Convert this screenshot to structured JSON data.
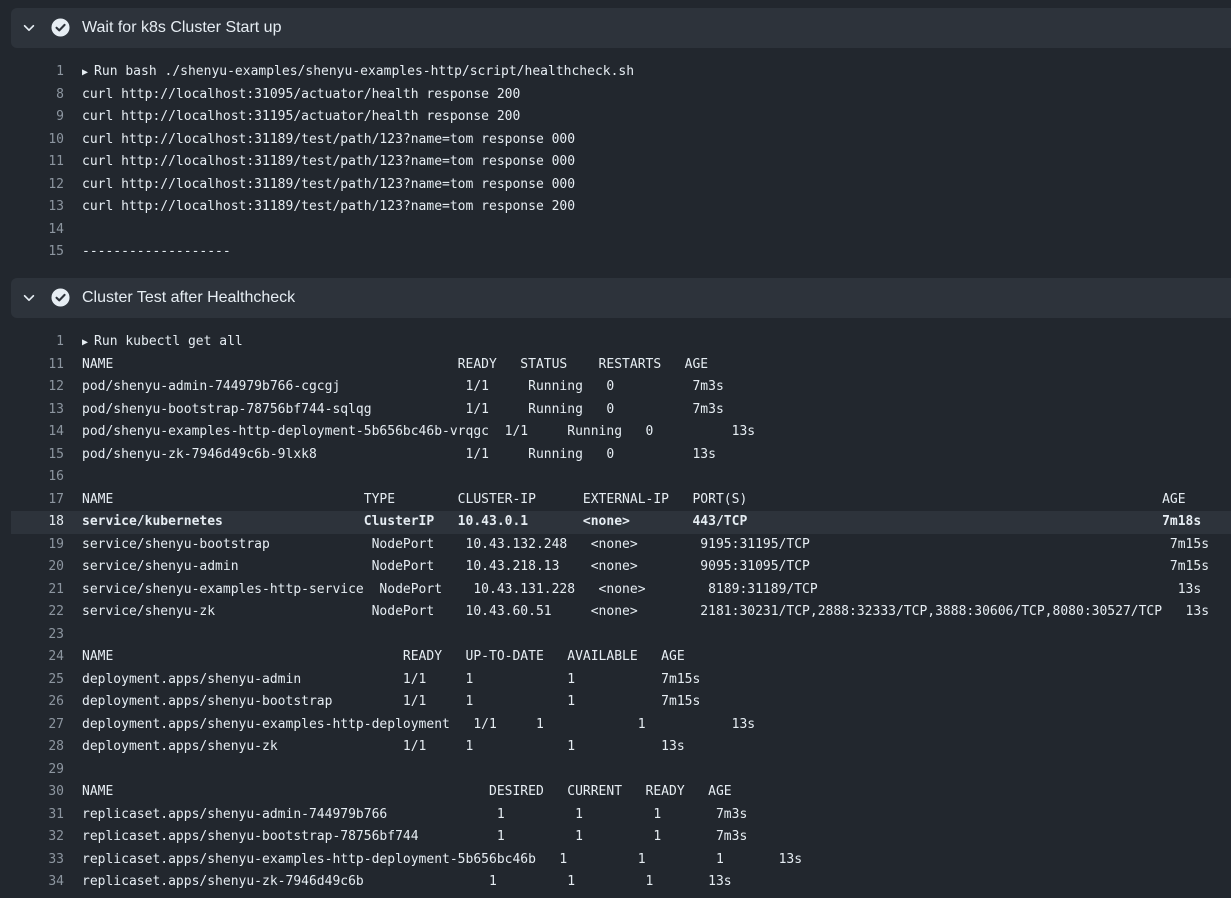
{
  "steps": [
    {
      "title": "Wait for k8s Cluster Start up",
      "status": "success",
      "lines": [
        {
          "num": "1",
          "text": "Run bash ./shenyu-examples/shenyu-examples-http/script/healthcheck.sh",
          "group": true
        },
        {
          "num": "8",
          "text": "curl http://localhost:31095/actuator/health response 200"
        },
        {
          "num": "9",
          "text": "curl http://localhost:31195/actuator/health response 200"
        },
        {
          "num": "10",
          "text": "curl http://localhost:31189/test/path/123?name=tom response 000"
        },
        {
          "num": "11",
          "text": "curl http://localhost:31189/test/path/123?name=tom response 000"
        },
        {
          "num": "12",
          "text": "curl http://localhost:31189/test/path/123?name=tom response 000"
        },
        {
          "num": "13",
          "text": "curl http://localhost:31189/test/path/123?name=tom response 200"
        },
        {
          "num": "14",
          "text": ""
        },
        {
          "num": "15",
          "text": "-------------------"
        }
      ]
    },
    {
      "title": "Cluster Test after Healthcheck",
      "status": "success",
      "lines": [
        {
          "num": "1",
          "text": "Run kubectl get all",
          "group": true
        },
        {
          "num": "11",
          "text": "NAME                                            READY   STATUS    RESTARTS   AGE"
        },
        {
          "num": "12",
          "text": "pod/shenyu-admin-744979b766-cgcgj                1/1     Running   0          7m3s"
        },
        {
          "num": "13",
          "text": "pod/shenyu-bootstrap-78756bf744-sqlqg            1/1     Running   0          7m3s"
        },
        {
          "num": "14",
          "text": "pod/shenyu-examples-http-deployment-5b656bc46b-vrqgc  1/1     Running   0          13s"
        },
        {
          "num": "15",
          "text": "pod/shenyu-zk-7946d49c6b-9lxk8                   1/1     Running   0          13s"
        },
        {
          "num": "16",
          "text": ""
        },
        {
          "num": "17",
          "text": "NAME                                TYPE        CLUSTER-IP      EXTERNAL-IP   PORT(S)                                                     AGE"
        },
        {
          "num": "18",
          "text": "service/kubernetes                  ClusterIP   10.43.0.1       <none>        443/TCP                                                     7m18s",
          "highlight": true
        },
        {
          "num": "19",
          "text": "service/shenyu-bootstrap             NodePort    10.43.132.248   <none>        9195:31195/TCP                                              7m15s"
        },
        {
          "num": "20",
          "text": "service/shenyu-admin                 NodePort    10.43.218.13    <none>        9095:31095/TCP                                              7m15s"
        },
        {
          "num": "21",
          "text": "service/shenyu-examples-http-service  NodePort    10.43.131.228   <none>        8189:31189/TCP                                              13s"
        },
        {
          "num": "22",
          "text": "service/shenyu-zk                    NodePort    10.43.60.51     <none>        2181:30231/TCP,2888:32333/TCP,3888:30606/TCP,8080:30527/TCP   13s"
        },
        {
          "num": "23",
          "text": ""
        },
        {
          "num": "24",
          "text": "NAME                                     READY   UP-TO-DATE   AVAILABLE   AGE"
        },
        {
          "num": "25",
          "text": "deployment.apps/shenyu-admin             1/1     1            1           7m15s"
        },
        {
          "num": "26",
          "text": "deployment.apps/shenyu-bootstrap         1/1     1            1           7m15s"
        },
        {
          "num": "27",
          "text": "deployment.apps/shenyu-examples-http-deployment   1/1     1            1           13s"
        },
        {
          "num": "28",
          "text": "deployment.apps/shenyu-zk                1/1     1            1           13s"
        },
        {
          "num": "29",
          "text": ""
        },
        {
          "num": "30",
          "text": "NAME                                                DESIRED   CURRENT   READY   AGE"
        },
        {
          "num": "31",
          "text": "replicaset.apps/shenyu-admin-744979b766              1         1         1       7m3s"
        },
        {
          "num": "32",
          "text": "replicaset.apps/shenyu-bootstrap-78756bf744          1         1         1       7m3s"
        },
        {
          "num": "33",
          "text": "replicaset.apps/shenyu-examples-http-deployment-5b656bc46b   1         1         1       13s"
        },
        {
          "num": "34",
          "text": "replicaset.apps/shenyu-zk-7946d49c6b                1         1         1       13s"
        }
      ]
    }
  ],
  "colors": {
    "background": "#22272e",
    "header": "#2d333b",
    "text": "#e6edf3",
    "line_number": "#8d96a0"
  }
}
